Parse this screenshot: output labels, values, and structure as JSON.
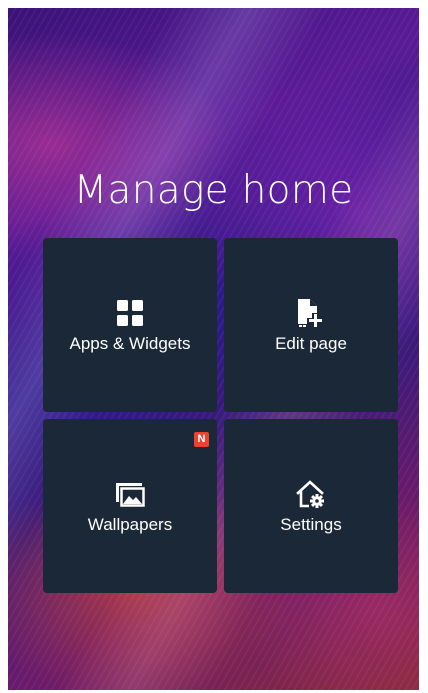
{
  "screen": {
    "title": "Manage home"
  },
  "tiles": [
    {
      "label": "Apps & Widgets",
      "icon": "grid-icon"
    },
    {
      "label": "Edit page",
      "icon": "edit-page-icon"
    },
    {
      "label": "Wallpapers",
      "icon": "wallpapers-icon",
      "badge": "N"
    },
    {
      "label": "Settings",
      "icon": "home-settings-icon"
    }
  ],
  "colors": {
    "tile_background": "#1b2838",
    "text": "#ffffff",
    "badge": "#e8442f"
  }
}
